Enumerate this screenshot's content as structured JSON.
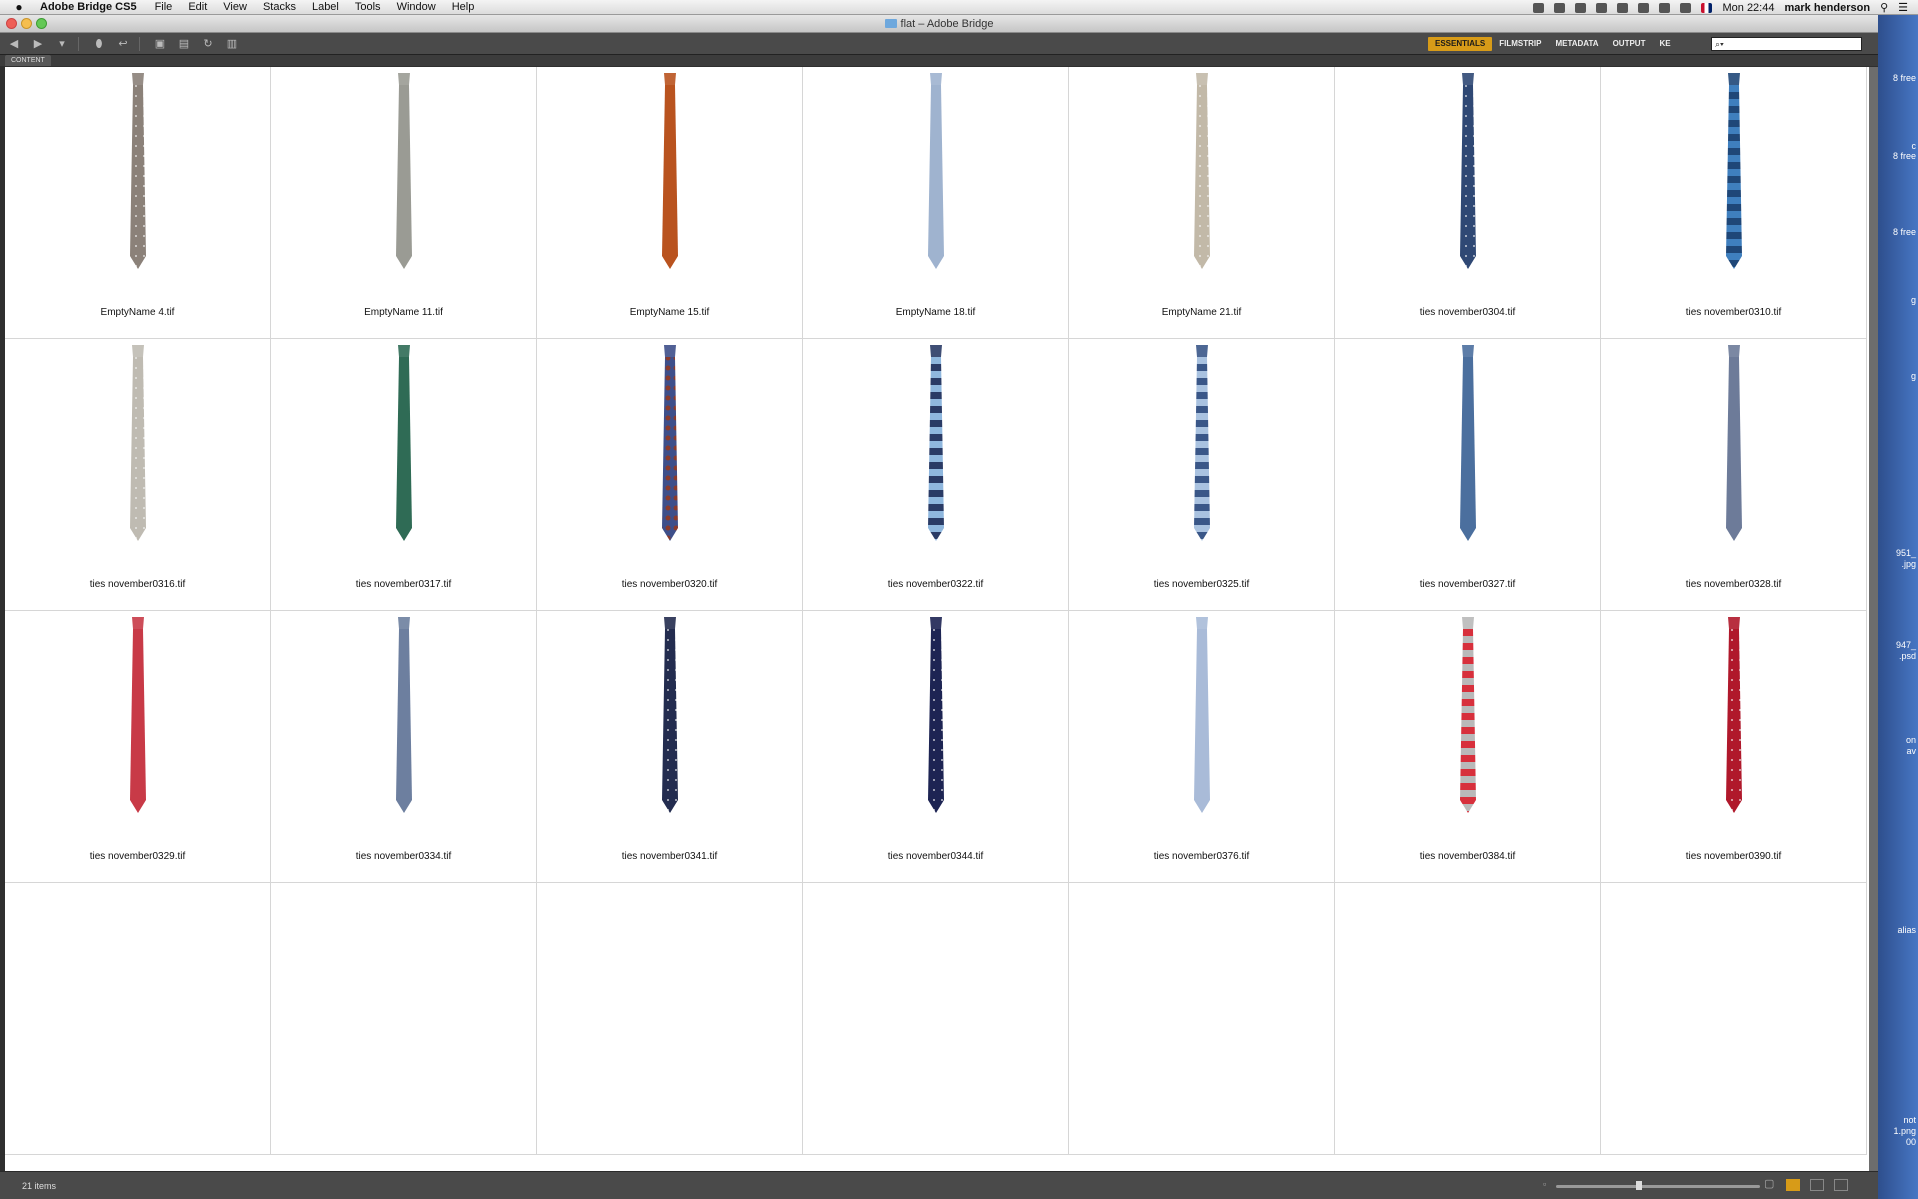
{
  "menubar": {
    "app_name": "Adobe Bridge CS5",
    "items": [
      "File",
      "Edit",
      "View",
      "Stacks",
      "Label",
      "Tools",
      "Window",
      "Help"
    ],
    "clock": "Mon 22:44",
    "user": "mark henderson"
  },
  "window": {
    "title": "flat – Adobe Bridge"
  },
  "toolbar": {
    "workspaces": [
      "ESSENTIALS",
      "FILMSTRIP",
      "METADATA",
      "OUTPUT",
      "KE"
    ],
    "active_workspace": "ESSENTIALS",
    "search_placeholder": "",
    "search_glyph": "⌕▾"
  },
  "panel": {
    "tab_label": "CONTENT"
  },
  "desktop_labels": [
    "8 free",
    "c",
    "8 free",
    "8 free",
    "g",
    "g",
    "951_",
    ".jpg",
    "947_",
    ".psd",
    "on",
    "av",
    "alias",
    "not",
    "1.png",
    "00"
  ],
  "thumbnails": [
    {
      "name": "EmptyName 4.tif",
      "color": "#8b8179",
      "pattern": "dots",
      "accent": "#a7c1d4"
    },
    {
      "name": "EmptyName 11.tif",
      "color": "#9a9b94",
      "pattern": "speckle",
      "accent": "#cfcfcf"
    },
    {
      "name": "EmptyName 15.tif",
      "color": "#b9531f",
      "pattern": "speckle",
      "accent": "#b9531f"
    },
    {
      "name": "EmptyName 18.tif",
      "color": "#9fb3cf",
      "pattern": "speckle",
      "accent": "#4a5f7b"
    },
    {
      "name": "EmptyName 21.tif",
      "color": "#c2b9a8",
      "pattern": "dots",
      "accent": "#5b5b5b"
    },
    {
      "name": "ties november0304.tif",
      "color": "#2f4874",
      "pattern": "dots",
      "accent": "#2f4874"
    },
    {
      "name": "ties november0310.tif",
      "color": "#3f7fbe",
      "pattern": "stripes",
      "accent": "#1f4778"
    },
    {
      "name": "ties november0316.tif",
      "color": "#bfbbb2",
      "pattern": "dots",
      "accent": "#bfbbb2"
    },
    {
      "name": "ties november0317.tif",
      "color": "#2f6b55",
      "pattern": "speckle",
      "accent": "#1e4a3b"
    },
    {
      "name": "ties november0320.tif",
      "color": "#3e4f8a",
      "pattern": "paisley",
      "accent": "#8a3a2c"
    },
    {
      "name": "ties november0322.tif",
      "color": "#8fb7de",
      "pattern": "stripes",
      "accent": "#2a3b66"
    },
    {
      "name": "ties november0325.tif",
      "color": "#a9c2e0",
      "pattern": "stripes",
      "accent": "#3a5788"
    },
    {
      "name": "ties november0327.tif",
      "color": "#4b6f9e",
      "pattern": "speckle",
      "accent": "#33547d"
    },
    {
      "name": "ties november0328.tif",
      "color": "#6d7b99",
      "pattern": "speckle",
      "accent": "#3b4a68"
    },
    {
      "name": "ties november0329.tif",
      "color": "#c83a47",
      "pattern": "speckle",
      "accent": "#9ec0d9"
    },
    {
      "name": "ties november0334.tif",
      "color": "#6d7f9f",
      "pattern": "speckle",
      "accent": "#4c5d7c"
    },
    {
      "name": "ties november0341.tif",
      "color": "#232c4f",
      "pattern": "dots",
      "accent": "#232c4f"
    },
    {
      "name": "ties november0344.tif",
      "color": "#1d2453",
      "pattern": "dots",
      "accent": "#1d2453"
    },
    {
      "name": "ties november0376.tif",
      "color": "#a9bbd8",
      "pattern": "speckle",
      "accent": "#8aa0c4"
    },
    {
      "name": "ties november0384.tif",
      "color": "#d7303c",
      "pattern": "stripes-red",
      "accent": "#b9b9b9"
    },
    {
      "name": "ties november0390.tif",
      "color": "#b0182b",
      "pattern": "dots",
      "accent": "#a7c1d4"
    }
  ],
  "status": {
    "item_count": "21 items"
  }
}
